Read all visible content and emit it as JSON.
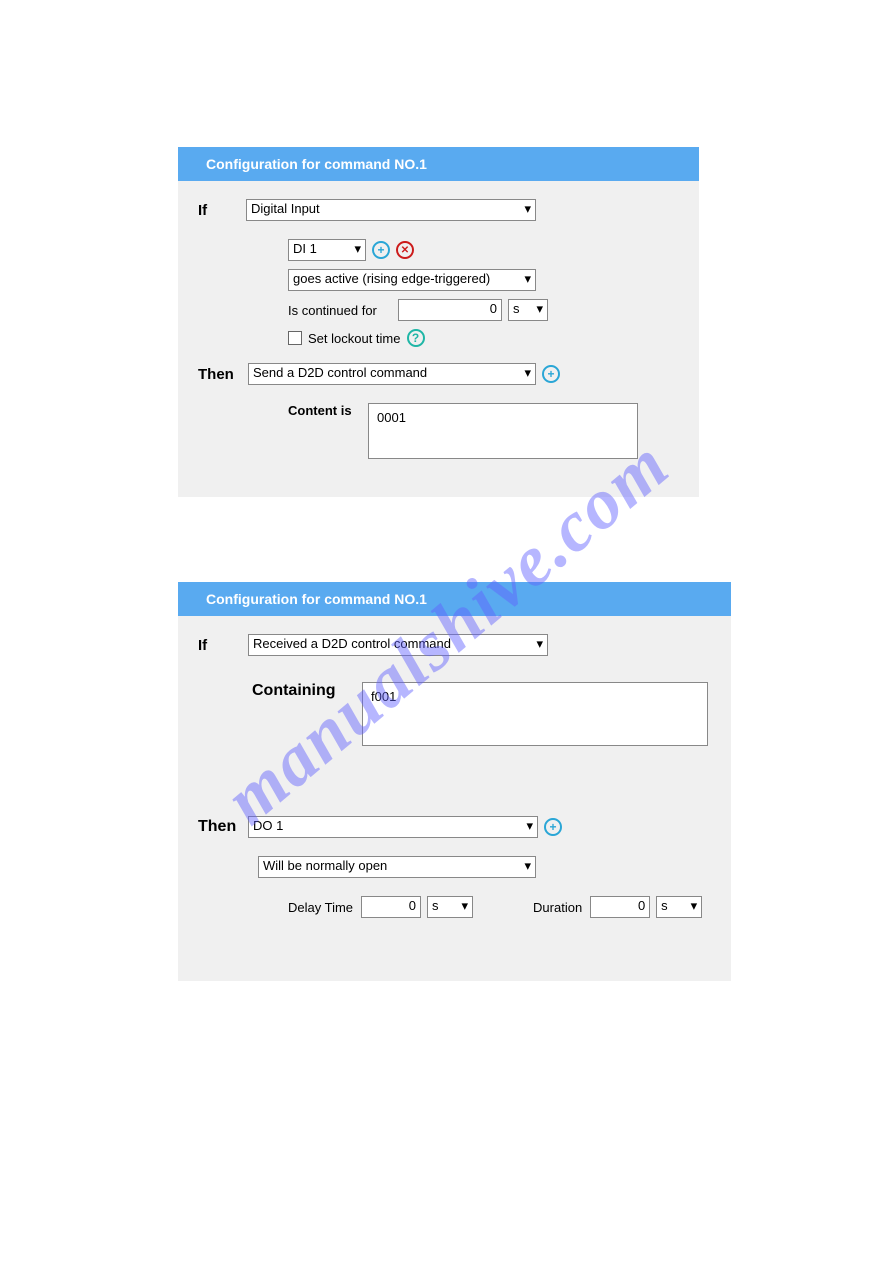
{
  "watermark": "manualshive.com",
  "panel1": {
    "title": "Configuration for command NO.1",
    "if_label": "If",
    "if_select": "Digital Input",
    "di_select": "DI 1",
    "trigger_select": "goes active (rising edge-triggered)",
    "continued_label": "Is continued for",
    "continued_value": "0",
    "continued_unit": "s",
    "lockout_label": "Set lockout time",
    "then_label": "Then",
    "then_select": "Send a D2D control command",
    "content_label": "Content is",
    "content_value": "0001"
  },
  "panel2": {
    "title": "Configuration for command NO.1",
    "if_label": "If",
    "if_select": "Received a D2D control command",
    "containing_label": "Containing",
    "containing_value": "f001",
    "then_label": "Then",
    "then_select": "DO 1",
    "state_select": "Will be normally open",
    "delay_label": "Delay Time",
    "delay_value": "0",
    "delay_unit": "s",
    "duration_label": "Duration",
    "duration_value": "0",
    "duration_unit": "s"
  }
}
